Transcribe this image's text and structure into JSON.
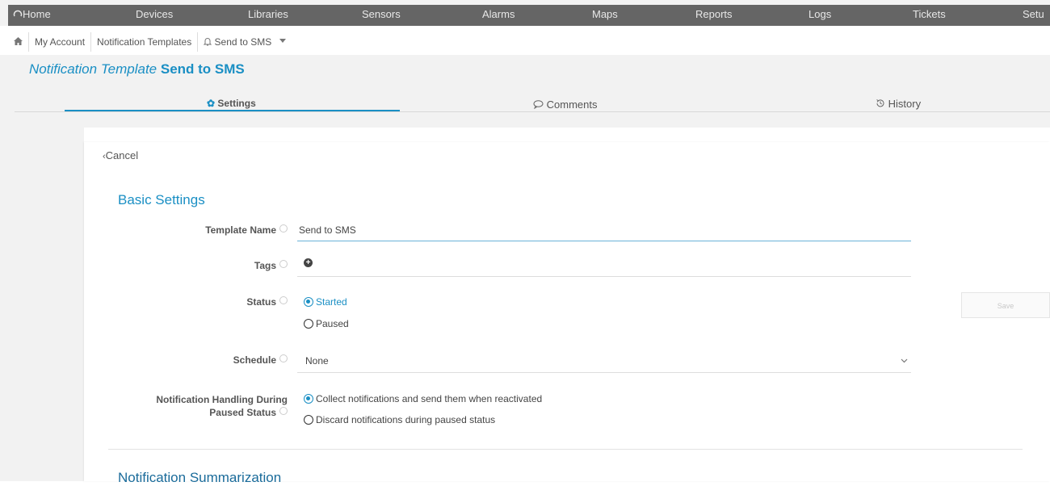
{
  "topnav": {
    "home": "Home",
    "items": [
      "Devices",
      "Libraries",
      "Sensors",
      "Alarms",
      "Maps",
      "Reports",
      "Logs",
      "Tickets",
      "Setu"
    ]
  },
  "breadcrumb": {
    "items": [
      "My Account",
      "Notification Templates",
      "Send to SMS"
    ]
  },
  "page": {
    "title_prefix": "Notification Template",
    "title_name": "Send to SMS"
  },
  "tabs": [
    {
      "label": "Settings",
      "icon": "gear-icon",
      "active": true
    },
    {
      "label": "Comments",
      "icon": "comment-icon",
      "active": false
    },
    {
      "label": "History",
      "icon": "history-icon",
      "active": false
    }
  ],
  "form": {
    "cancel": "Cancel",
    "section_basic": "Basic Settings",
    "template_name_label": "Template Name",
    "template_name_value": "Send to SMS",
    "tags_label": "Tags",
    "status_label": "Status",
    "status_started": "Started",
    "status_paused": "Paused",
    "schedule_label": "Schedule",
    "schedule_value": "None",
    "handling_label_1": "Notification Handling During",
    "handling_label_2": "Paused Status",
    "handling_collect": "Collect notifications and send them when reactivated",
    "handling_discard": "Discard notifications during paused status",
    "save": "Save",
    "section_summarization": "Notification Summarization"
  },
  "colors": {
    "accent": "#1a8fc4",
    "nav_bg": "#656565",
    "page_bg": "#f2f2f2"
  }
}
